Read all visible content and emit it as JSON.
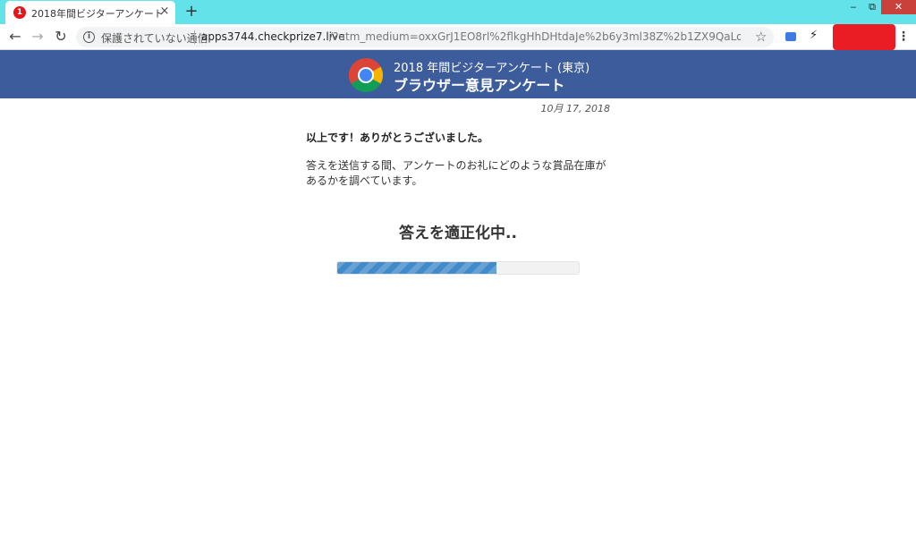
{
  "browser": {
    "tab": {
      "title": "2018年間ビジターアンケート",
      "badge": "1"
    },
    "window_controls": {
      "minimize": "‒",
      "restore": "⧉",
      "close": "✕"
    },
    "address_bar": {
      "security_label": "保護されていない通信",
      "domain": "apps3744.checkprize7.live",
      "path": "/?utm_medium=oxxGrJ1EO8rl%2flkgHhDHtdaJe%2b6y3ml38Z%2b1ZX9QaLo%3d…"
    },
    "icons": {
      "back": "←",
      "forward": "→",
      "reload": "↻",
      "info": "i",
      "star": "☆",
      "bolt": "⚡",
      "menu": "⋮",
      "close_tab": "×",
      "new_tab": "+"
    }
  },
  "header": {
    "subtitle": "2018 年間ビジターアンケート (東京)",
    "title": "ブラウザー意見アンケート"
  },
  "content": {
    "date": "10月 17, 2018",
    "thanks": "以上です！ありがとうございました。",
    "message": "答えを送信する間、アンケートのお礼にどのような賞品在庫があるかを調べています。",
    "status": "答えを適正化中..",
    "progress_percent": 66
  },
  "colors": {
    "tabstrip": "#63e3e9",
    "header_bg": "#3c5c9c",
    "progress": "#428bca",
    "close_button": "#c9413a"
  }
}
